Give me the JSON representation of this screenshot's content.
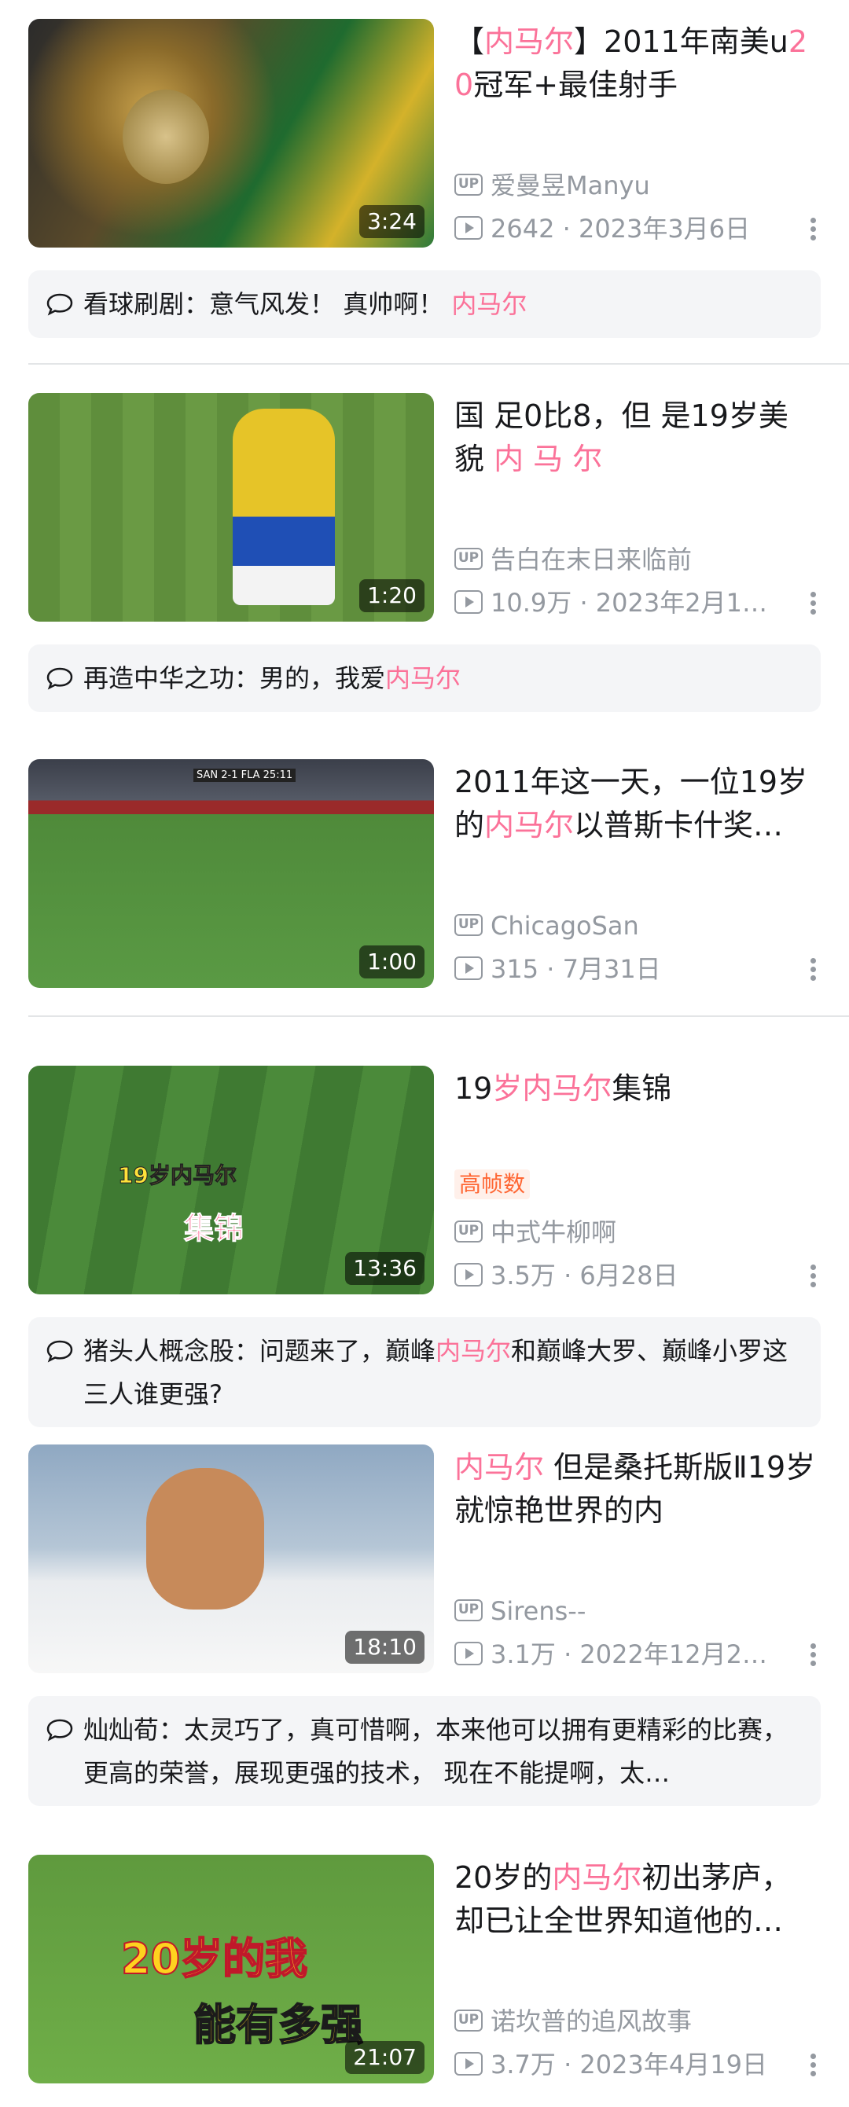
{
  "videos": [
    {
      "title_parts": [
        "【",
        "内马尔",
        "】2011年南美u",
        "20",
        "冠军+最佳射手"
      ],
      "uploader": "爱曼昱Manyu",
      "views": "2642",
      "date": "2023年3月6日",
      "duration": "3:24",
      "comment": {
        "user": "看球刷剧：",
        "text": "意气风发！ 真帅啊！ ",
        "highlight": "内马尔"
      }
    },
    {
      "title_parts": [
        "国 足0比8，但 是19岁美 貌 ",
        "内 马 尔"
      ],
      "uploader": "告白在末日来临前",
      "views": "10.9万",
      "date": "2023年2月1…",
      "duration": "1:20",
      "comment": {
        "user": "再造中华之功：",
        "text": "男的，我爱",
        "highlight": "内马尔"
      }
    },
    {
      "title_parts": [
        "2011年这一天，一位19岁的",
        "内马尔",
        "以普斯卡什奖…"
      ],
      "uploader": "ChicagoSan",
      "views": "315",
      "date": "7月31日",
      "duration": "1:00",
      "thumb_caption": "SAN 2-1 FLA 25:11"
    },
    {
      "title_parts": [
        "19",
        "岁内马尔",
        "集锦"
      ],
      "tag": "高帧数",
      "uploader": "中式牛柳啊",
      "views": "3.5万",
      "date": "6月28日",
      "duration": "13:36",
      "thumb_caption_1": "19岁内马尔",
      "thumb_caption_2": "集锦",
      "comment": {
        "user": "猪头人概念股：",
        "text": "问题来了，巅峰",
        "highlight": "内马尔",
        "text_after": "和巅峰大罗、巅峰小罗这三人谁更强?"
      }
    },
    {
      "title_parts": [
        "内马尔",
        " 但是桑托斯版Ⅱ19岁就惊艳世界的内"
      ],
      "uploader": "Sirens--",
      "views": "3.1万",
      "date": "2022年12月2…",
      "duration": "18:10",
      "comment": {
        "user": "灿灿荀：",
        "text": "太灵巧了，真可惜啊，本来他可以拥有更精彩的比赛，更高的荣誉，展现更强的技术， 现在不能提啊，太…"
      }
    },
    {
      "title_parts": [
        "20岁的",
        "内马尔",
        "初出茅庐，却已让全世界知道他的…"
      ],
      "uploader": "诺坎普的追风故事",
      "views": "3.7万",
      "date": "2023年4月19日",
      "duration": "21:07",
      "thumb_caption_1": "20岁的我",
      "thumb_caption_2": "能有多强"
    }
  ],
  "icons": {
    "uploader": "up-icon",
    "play": "play-count-icon",
    "comment": "comment-bubble-icon",
    "more": "more-vertical-icon"
  },
  "colors": {
    "highlight": "#fb7299",
    "meta": "#9499a0",
    "comment_bg": "#f4f5f7",
    "tag": "#ff6633"
  }
}
